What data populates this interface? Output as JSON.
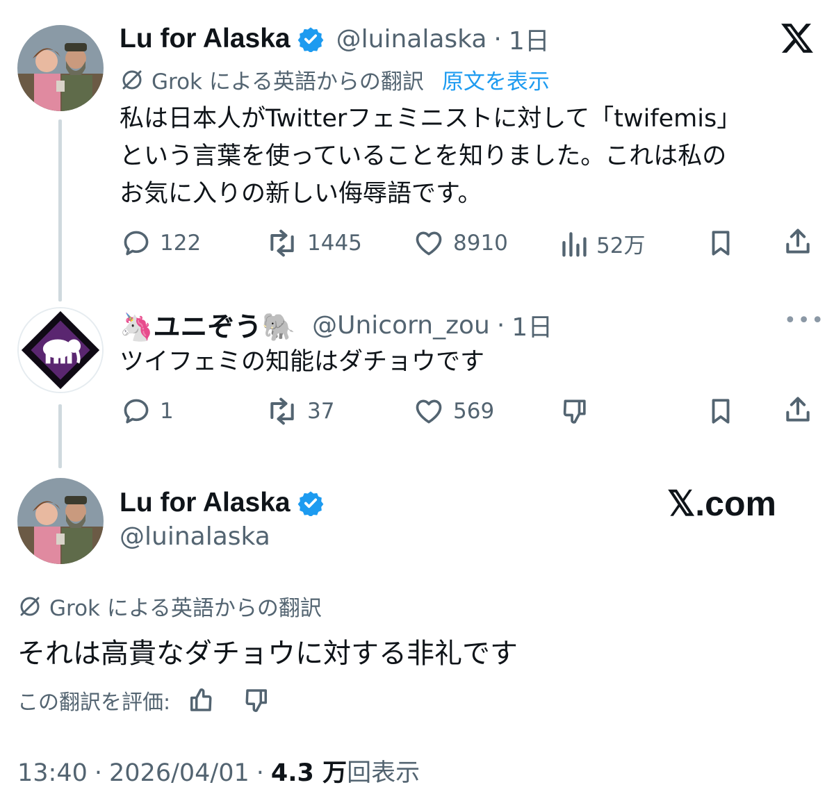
{
  "tweet1": {
    "display_name": "Lu for Alaska",
    "handle": "@luinalaska",
    "sep": "·",
    "time": "1日",
    "translation_label": "Grok による英語からの翻訳",
    "show_original": "原文を表示",
    "body_lines": [
      "私は日本人がTwitterフェミニストに対して「twifemis」",
      "という言葉を使っていることを知りました。これは私の",
      "お気に入りの新しい侮辱語です。"
    ],
    "replies": "122",
    "reposts": "1445",
    "likes": "8910",
    "views": "52万",
    "avatar_icon": "person-photo-avatar",
    "brand_icon": "x-logo-icon"
  },
  "tweet2": {
    "display_name": "🦄ユニぞう🐘",
    "handle": "@Unicorn_zou",
    "sep": "·",
    "time": "1日",
    "body": "ツイフェミの知能はダチョウです",
    "replies": "1",
    "reposts": "37",
    "likes": "569",
    "avatar_icon": "elephant-diamond-avatar",
    "more_icon": "more-dots-icon"
  },
  "tweet3": {
    "display_name": "Lu for Alaska",
    "handle": "@luinalaska",
    "brand_text": "𝕏.com",
    "translation_label": "Grok による英語からの翻訳",
    "body": "それは高貴なダチョウに対する非礼です",
    "rate_label": "この翻訳を評価:",
    "time": "13:40",
    "date": "2026/04/01",
    "views_value": "4.3 万",
    "views_label": "回表示",
    "sep": "·"
  },
  "colors": {
    "text_primary": "#0f1419",
    "text_secondary": "#536471",
    "link": "#1d9bf0",
    "verified": "#1d9bf0",
    "thread_line": "#cfd9de"
  }
}
